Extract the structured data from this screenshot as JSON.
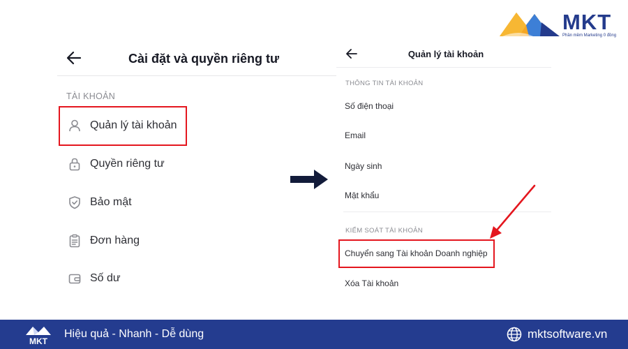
{
  "brand": {
    "name": "MKT",
    "subtitle": "Phần mềm Marketing 0 đồng",
    "colors": {
      "navy": "#243b8c",
      "orange": "#f5a623",
      "blue": "#3d7fd6",
      "highlight": "#e4161e"
    }
  },
  "left_screen": {
    "title": "Cài đặt và quyền riêng tư",
    "section_label": "TÀI KHOẢN",
    "items": [
      {
        "label": "Quản lý tài khoản",
        "icon": "user-icon"
      },
      {
        "label": "Quyền riêng tư",
        "icon": "lock-icon"
      },
      {
        "label": "Bảo mật",
        "icon": "shield-icon"
      },
      {
        "label": "Đơn hàng",
        "icon": "clipboard-icon"
      },
      {
        "label": "Số dư",
        "icon": "wallet-icon"
      }
    ]
  },
  "right_screen": {
    "title": "Quản lý tài khoản",
    "section_info": "THÔNG TIN TÀI KHOẢN",
    "info_items": [
      "Số điện thoại",
      "Email",
      "Ngày sinh",
      "Mật khẩu"
    ],
    "section_control": "KIỂM SOÁT TÀI KHOẢN",
    "control_items": [
      "Chuyển sang Tài khoản Doanh nghiệp",
      "Xóa Tài khoản"
    ]
  },
  "footer": {
    "tagline": "Hiệu quả - Nhanh - Dễ dùng",
    "website": "mktsoftware.vn",
    "logo_text": "MKT"
  }
}
